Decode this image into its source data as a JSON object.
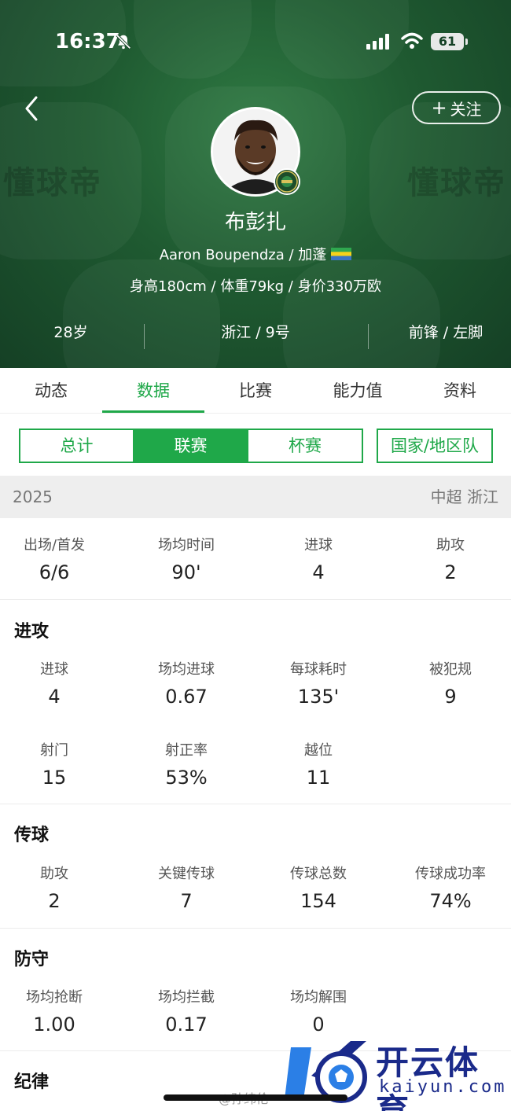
{
  "status_bar": {
    "time": "16:37",
    "battery": "61"
  },
  "header": {
    "watermark_left": "懂球帝",
    "watermark_right": "懂球帝",
    "follow_label": "关注",
    "player_name": "布彭扎",
    "player_en_country": "Aaron Boupendza / 加蓬",
    "player_body": "身高180cm / 体重79kg / 身价330万欧",
    "age": "28岁",
    "team_number": "浙江 / 9号",
    "position_foot": "前锋 / 左脚"
  },
  "tabs": [
    {
      "label": "动态"
    },
    {
      "label": "数据"
    },
    {
      "label": "比赛"
    },
    {
      "label": "能力值"
    },
    {
      "label": "资料"
    }
  ],
  "segments": [
    {
      "label": "总计"
    },
    {
      "label": "联赛"
    },
    {
      "label": "杯赛"
    },
    {
      "label": "国家/地区队"
    }
  ],
  "season": {
    "year": "2025",
    "competition": "中超 浙江"
  },
  "summary": [
    {
      "label": "出场/首发",
      "value": "6/6"
    },
    {
      "label": "场均时间",
      "value": "90'"
    },
    {
      "label": "进球",
      "value": "4"
    },
    {
      "label": "助攻",
      "value": "2"
    }
  ],
  "attack": {
    "title": "进攻",
    "stats": [
      {
        "label": "进球",
        "value": "4"
      },
      {
        "label": "场均进球",
        "value": "0.67"
      },
      {
        "label": "每球耗时",
        "value": "135'"
      },
      {
        "label": "被犯规",
        "value": "9"
      },
      {
        "label": "射门",
        "value": "15"
      },
      {
        "label": "射正率",
        "value": "53%"
      },
      {
        "label": "越位",
        "value": "11"
      }
    ]
  },
  "passing": {
    "title": "传球",
    "stats": [
      {
        "label": "助攻",
        "value": "2"
      },
      {
        "label": "关键传球",
        "value": "7"
      },
      {
        "label": "传球总数",
        "value": "154"
      },
      {
        "label": "传球成功率",
        "value": "74%"
      }
    ]
  },
  "defense": {
    "title": "防守",
    "stats": [
      {
        "label": "场均抢断",
        "value": "1.00"
      },
      {
        "label": "场均拦截",
        "value": "0.17"
      },
      {
        "label": "场均解围",
        "value": "0"
      }
    ]
  },
  "discipline": {
    "title": "纪律"
  },
  "overlay": {
    "weibo": "@孙纬伦",
    "brand_cn": "开云体育",
    "brand_en": "kaiyun.com"
  },
  "colors": {
    "accent": "#1fa849",
    "header_bg": "#1f5a31",
    "brand": "#1a2a8a"
  }
}
